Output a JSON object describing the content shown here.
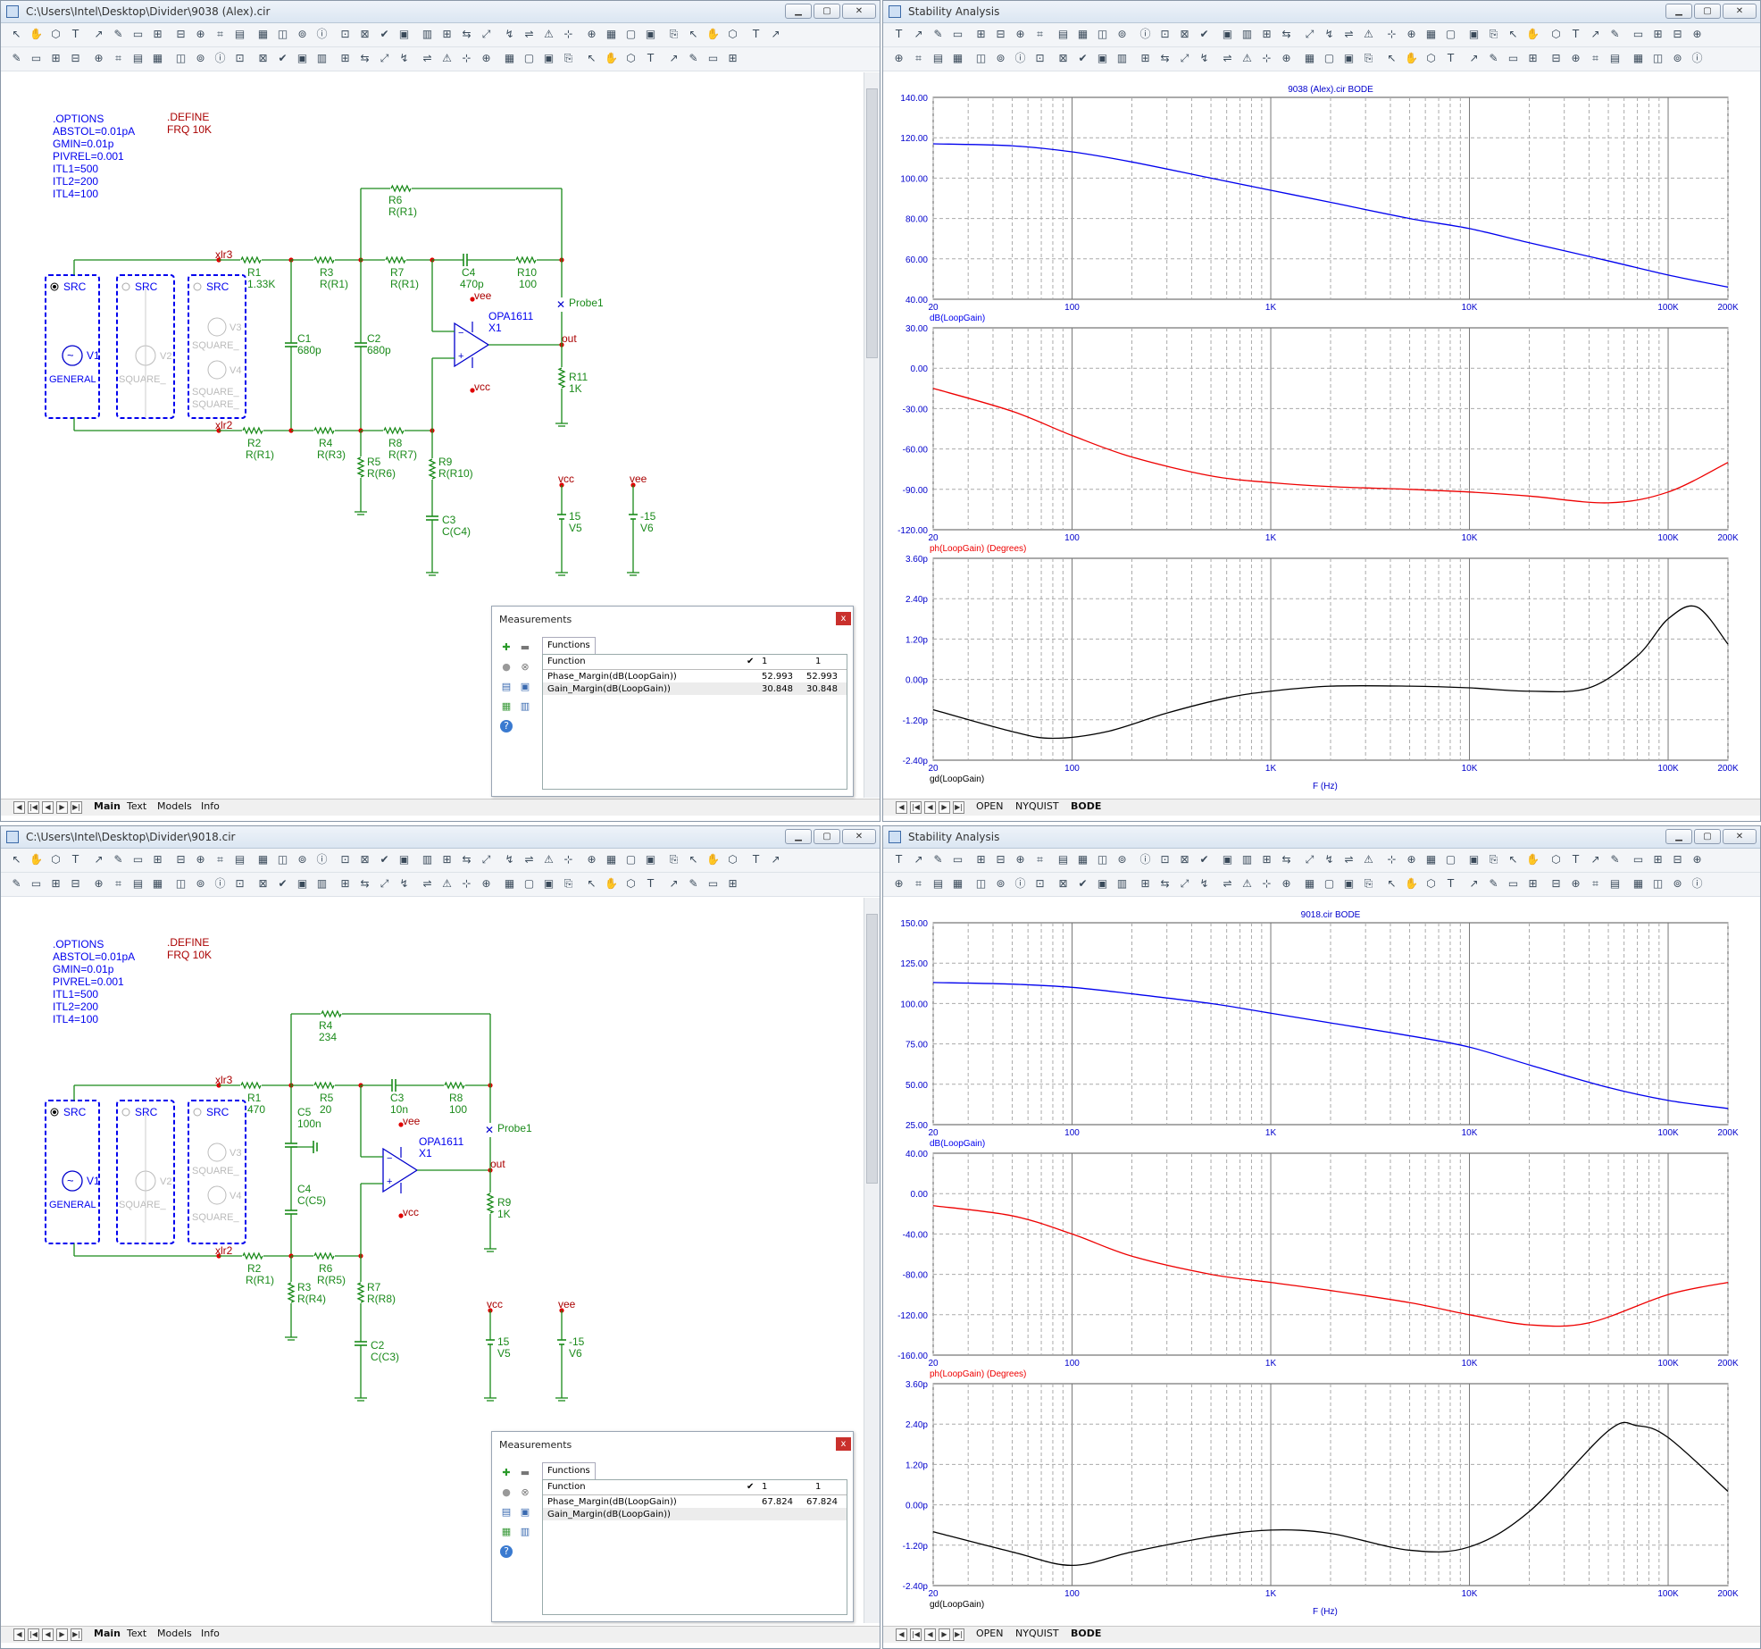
{
  "windows": [
    {
      "title": "C:\\Users\\Intel\\Desktop\\Divider\\9038 (Alex).cir",
      "options": [
        ".OPTIONS",
        "ABSTOL=0.01pA",
        "GMIN=0.01p",
        "PIVREL=0.001",
        "ITL1=500",
        "ITL2=200",
        "ITL4=100"
      ],
      "define": [
        ".DEFINE",
        "FRQ 10K"
      ],
      "tabs": [
        "Main",
        "Text",
        "Models",
        "Info"
      ],
      "measurements": {
        "title": "Measurements",
        "tab": "Functions",
        "headers": [
          "Function",
          "1",
          "1"
        ],
        "rows": [
          {
            "fn": "Phase_Margin(dB(LoopGain))",
            "v1": "52.993",
            "v2": "52.993"
          },
          {
            "fn": "Gain_Margin(dB(LoopGain))",
            "v1": "30.848",
            "v2": "30.848"
          }
        ]
      },
      "labels": {
        "src1": "SRC",
        "src2": "SRC",
        "src3": "SRC",
        "v1": "V1",
        "general": "GENERAL",
        "v2": "V2",
        "square1": "SQUARE_",
        "v3": "V3",
        "square2": "SQUARE_",
        "v4": "V4",
        "square3": "SQUARE_",
        "square4": "SQUARE_",
        "xlr3": "xlr3",
        "xlr2": "xlr2",
        "r1": "R1",
        "r1v": "1.33K",
        "r2": "R2",
        "r2v": "R(R1)",
        "r3": "R3",
        "r3v": "R(R1)",
        "r4": "R4",
        "r4v": "R(R3)",
        "r5": "R5",
        "r5v": "R(R6)",
        "r6": "R6",
        "r6v": "R(R1)",
        "r7": "R7",
        "r7v": "R(R1)",
        "r8": "R8",
        "r8v": "R(R7)",
        "r9": "R9",
        "r9v": "R(R10)",
        "r10": "R10",
        "r10v": "100",
        "r11": "R11",
        "r11v": "1K",
        "c1": "C1",
        "c1v": "680p",
        "c2": "C2",
        "c2v": "680p",
        "c3": "C3",
        "c3v": "C(C4)",
        "c4": "C4",
        "c4v": "470p",
        "opa": "OPA1611",
        "x1": "X1",
        "vee": "vee",
        "vcc": "vcc",
        "out": "out",
        "probe": "Probe1",
        "vcc2": "vcc",
        "vee2": "vee",
        "v5": "V5",
        "v5v": "15",
        "v6": "V6",
        "v6v": "-15"
      }
    },
    {
      "title": "C:\\Users\\Intel\\Desktop\\Divider\\9018.cir",
      "options": [
        ".OPTIONS",
        "ABSTOL=0.01pA",
        "GMIN=0.01p",
        "PIVREL=0.001",
        "ITL1=500",
        "ITL2=200",
        "ITL4=100"
      ],
      "define": [
        ".DEFINE",
        "FRQ 10K"
      ],
      "tabs": [
        "Main",
        "Text",
        "Models",
        "Info"
      ],
      "measurements": {
        "title": "Measurements",
        "tab": "Functions",
        "headers": [
          "Function",
          "1",
          "1"
        ],
        "rows": [
          {
            "fn": "Phase_Margin(dB(LoopGain))",
            "v1": "67.824",
            "v2": "67.824"
          },
          {
            "fn": "Gain_Margin(dB(LoopGain))",
            "v1": "",
            "v2": ""
          }
        ]
      },
      "labels": {
        "src1": "SRC",
        "src2": "SRC",
        "src3": "SRC",
        "v1": "V1",
        "general": "GENERAL",
        "v2": "V2",
        "square1": "SQUARE_",
        "v3": "V3",
        "square2": "SQUARE_",
        "v4": "V4",
        "square3": "SQUARE_",
        "xlr3": "xlr3",
        "xlr2": "xlr2",
        "r1": "R1",
        "r1v": "470",
        "r2": "R2",
        "r2v": "R(R1)",
        "r3": "R3",
        "r3v": "R(R4)",
        "r4": "R4",
        "r4v": "234",
        "r5": "R5",
        "r5v": "20",
        "r6": "R6",
        "r6v": "R(R5)",
        "r7": "R7",
        "r7v": "R(R8)",
        "r8": "R8",
        "r8v": "100",
        "r9": "R9",
        "r9v": "1K",
        "c2": "C2",
        "c2v": "C(C3)",
        "c3": "C3",
        "c3v": "10n",
        "c4": "C4",
        "c4v": "C(C5)",
        "c5": "C5",
        "c5v": "100n",
        "opa": "OPA1611",
        "x1": "X1",
        "vee": "vee",
        "vcc": "vcc",
        "out": "out",
        "probe": "Probe1",
        "vcc2": "vcc",
        "vee2": "vee",
        "v5": "V5",
        "v5v": "15",
        "v6": "V6",
        "v6v": "-15"
      }
    }
  ],
  "analysis": [
    {
      "title": "Stability Analysis",
      "tabs": [
        "OPEN",
        "NYQUIST",
        "BODE"
      ],
      "plot_title": "9038 (Alex).cir BODE",
      "x_label": "F (Hz)",
      "x_ticks": [
        "20",
        "100",
        "1K",
        "10K",
        "100K",
        "200K"
      ],
      "panels": [
        {
          "name": "dB(LoopGain)",
          "yticks": [
            "140.00",
            "120.00",
            "100.00",
            "80.00",
            "60.00",
            "40.00"
          ],
          "color": "#0000ee"
        },
        {
          "name": "ph(LoopGain) (Degrees)",
          "yticks": [
            "30.00",
            "0.00",
            "-30.00",
            "-60.00",
            "-90.00",
            "-120.00"
          ],
          "color": "#ee0000"
        },
        {
          "name": "gd(LoopGain)",
          "yticks": [
            "3.60p",
            "2.40p",
            "1.20p",
            "0.00p",
            "-1.20p",
            "-2.40p"
          ],
          "color": "#000000"
        }
      ]
    },
    {
      "title": "Stability Analysis",
      "tabs": [
        "OPEN",
        "NYQUIST",
        "BODE"
      ],
      "plot_title": "9018.cir BODE",
      "x_label": "F (Hz)",
      "x_ticks": [
        "20",
        "100",
        "1K",
        "10K",
        "100K",
        "200K"
      ],
      "panels": [
        {
          "name": "dB(LoopGain)",
          "yticks": [
            "150.00",
            "125.00",
            "100.00",
            "75.00",
            "50.00",
            "25.00"
          ],
          "color": "#0000ee"
        },
        {
          "name": "ph(LoopGain) (Degrees)",
          "yticks": [
            "40.00",
            "0.00",
            "-40.00",
            "-80.00",
            "-120.00",
            "-160.00"
          ],
          "color": "#ee0000"
        },
        {
          "name": "gd(LoopGain)",
          "yticks": [
            "3.60p",
            "2.40p",
            "1.20p",
            "0.00p",
            "-1.20p",
            "-2.40p"
          ],
          "color": "#000000"
        }
      ]
    }
  ],
  "chart_data": [
    {
      "type": "line",
      "title": "9038 (Alex).cir BODE",
      "xlabel": "F (Hz)",
      "xscale": "log",
      "xlim": [
        20,
        200000
      ],
      "panels": [
        {
          "ylabel": "dB(LoopGain)",
          "ylim": [
            40,
            140
          ],
          "series": [
            {
              "name": "dB(LoopGain)",
              "color": "#0000ee",
              "x": [
                20,
                50,
                100,
                200,
                500,
                1000,
                2000,
                5000,
                10000,
                20000,
                50000,
                100000,
                200000
              ],
              "y": [
                117,
                116,
                113,
                108,
                100,
                94,
                88,
                80,
                75,
                68,
                59,
                52,
                46
              ]
            }
          ]
        },
        {
          "ylabel": "ph(LoopGain) (Degrees)",
          "ylim": [
            -120,
            30
          ],
          "series": [
            {
              "name": "ph(LoopGain) (Degrees)",
              "color": "#ee0000",
              "x": [
                20,
                50,
                100,
                200,
                500,
                1000,
                2000,
                5000,
                10000,
                20000,
                50000,
                100000,
                200000
              ],
              "y": [
                -15,
                -32,
                -50,
                -66,
                -80,
                -85,
                -88,
                -90,
                -92,
                -95,
                -100,
                -92,
                -70
              ]
            }
          ]
        },
        {
          "ylabel": "gd(LoopGain)",
          "ylim": [
            -2.4,
            3.6
          ],
          "series": [
            {
              "name": "gd(LoopGain)",
              "color": "#000000",
              "x": [
                20,
                50,
                80,
                150,
                300,
                600,
                1000,
                2000,
                5000,
                10000,
                20000,
                40000,
                70000,
                100000,
                140000,
                200000
              ],
              "y": [
                -0.9,
                -1.55,
                -1.75,
                -1.55,
                -1.0,
                -0.55,
                -0.35,
                -0.2,
                -0.2,
                -0.25,
                -0.35,
                -0.25,
                0.7,
                1.8,
                2.15,
                1.05
              ]
            }
          ]
        }
      ]
    },
    {
      "type": "line",
      "title": "9018.cir BODE",
      "xlabel": "F (Hz)",
      "xscale": "log",
      "xlim": [
        20,
        200000
      ],
      "panels": [
        {
          "ylabel": "dB(LoopGain)",
          "ylim": [
            25,
            150
          ],
          "series": [
            {
              "name": "dB(LoopGain)",
              "color": "#0000ee",
              "x": [
                20,
                50,
                100,
                200,
                500,
                1000,
                2000,
                5000,
                10000,
                20000,
                50000,
                100000,
                200000
              ],
              "y": [
                113,
                112,
                110,
                106,
                100,
                94,
                88,
                80,
                73,
                62,
                48,
                40,
                35
              ]
            }
          ]
        },
        {
          "ylabel": "ph(LoopGain) (Degrees)",
          "ylim": [
            -160,
            40
          ],
          "series": [
            {
              "name": "ph(LoopGain) (Degrees)",
              "color": "#ee0000",
              "x": [
                20,
                50,
                100,
                200,
                500,
                1000,
                2000,
                5000,
                10000,
                20000,
                40000,
                100000,
                200000
              ],
              "y": [
                -12,
                -22,
                -40,
                -62,
                -80,
                -88,
                -96,
                -108,
                -120,
                -130,
                -128,
                -100,
                -88
              ]
            }
          ]
        },
        {
          "ylabel": "gd(LoopGain)",
          "ylim": [
            -2.4,
            3.6
          ],
          "series": [
            {
              "name": "gd(LoopGain)",
              "color": "#000000",
              "x": [
                20,
                50,
                100,
                200,
                500,
                1000,
                2000,
                5000,
                10000,
                20000,
                50000,
                70000,
                100000,
                200000
              ],
              "y": [
                -0.8,
                -1.4,
                -1.8,
                -1.4,
                -0.95,
                -0.75,
                -0.85,
                -1.35,
                -1.25,
                -0.2,
                2.2,
                2.35,
                2.0,
                0.4
              ]
            }
          ]
        }
      ]
    }
  ]
}
